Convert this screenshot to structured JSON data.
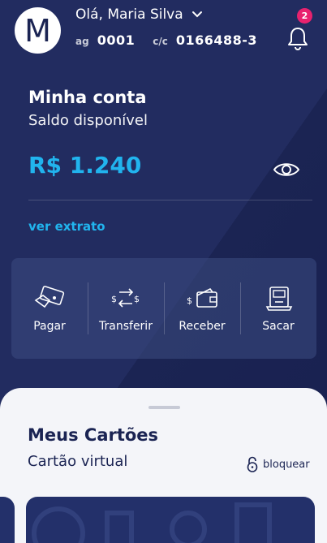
{
  "header": {
    "avatar_letter": "M",
    "greeting": "Olá, Maria Silva",
    "agency_label": "ag",
    "agency_value": "0001",
    "account_label": "c/c",
    "account_value": "0166488-3",
    "notification_count": "2"
  },
  "account": {
    "title": "Minha conta",
    "subtitle": "Saldo disponível",
    "balance": "R$ 1.240",
    "statement_link": "ver extrato"
  },
  "actions": [
    {
      "label": "Pagar",
      "icon": "pay-icon"
    },
    {
      "label": "Transferir",
      "icon": "transfer-icon"
    },
    {
      "label": "Receber",
      "icon": "receive-icon"
    },
    {
      "label": "Sacar",
      "icon": "withdraw-icon"
    }
  ],
  "cards": {
    "title": "Meus Cartões",
    "subtitle": "Cartão virtual",
    "lock_label": "bloquear"
  },
  "colors": {
    "background": "#1b2453",
    "accent": "#21b4ee",
    "badge": "#e8226e",
    "sheet": "#f4f5f9"
  }
}
